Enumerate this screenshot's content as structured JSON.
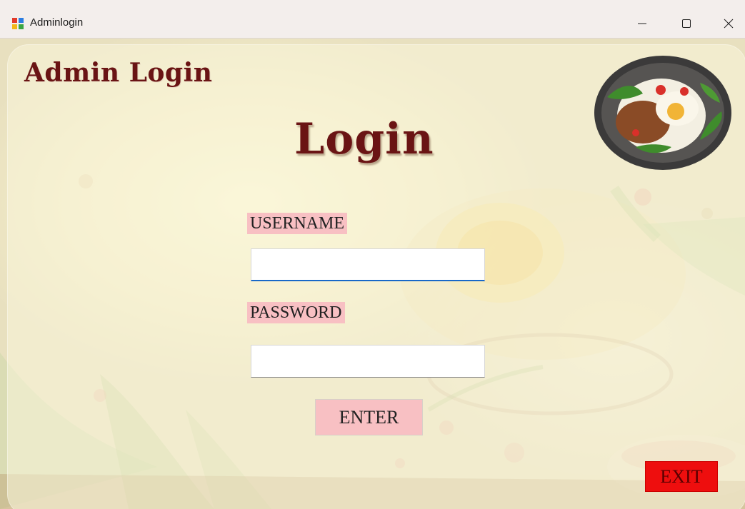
{
  "window": {
    "title": "Adminlogin",
    "controls": {
      "minimize": "minimize-icon",
      "maximize": "maximize-icon",
      "close": "close-icon"
    }
  },
  "form": {
    "heading": "Admin Login",
    "login_title": "Login",
    "username_label": "USERNAME",
    "username_value": "",
    "password_label": "PASSWORD",
    "password_value": "",
    "enter_button": "ENTER",
    "exit_button": "EXIT"
  },
  "logo": {
    "icon": "food-plate-logo"
  },
  "colors": {
    "title": "#6a1414",
    "label_bg": "#f8c0c3",
    "enter_bg": "#f8c0c3",
    "exit_bg": "#ee0e0e",
    "focus_underline": "#1868c8"
  }
}
